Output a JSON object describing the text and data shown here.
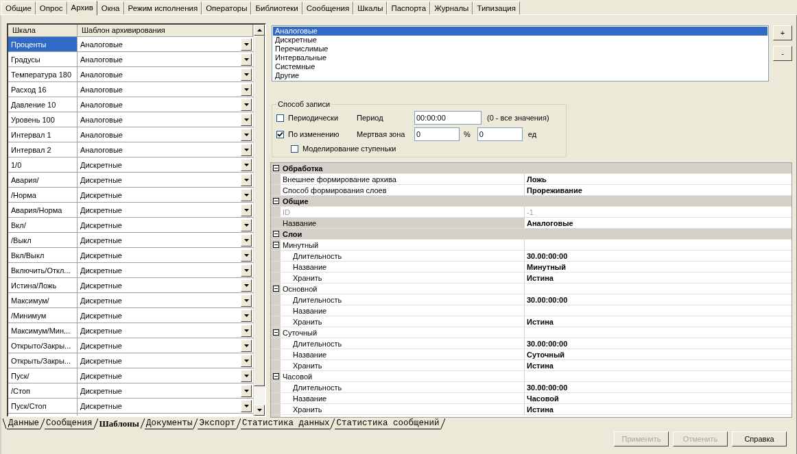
{
  "top_tabs": [
    {
      "label": "Общие",
      "selected": false
    },
    {
      "label": "Опрос",
      "selected": false
    },
    {
      "label": "Архив",
      "selected": true
    },
    {
      "label": "Окна",
      "selected": false
    },
    {
      "label": "Режим исполнения",
      "selected": false
    },
    {
      "label": "Операторы",
      "selected": false
    },
    {
      "label": "Библиотеки",
      "selected": false
    },
    {
      "label": "Сообщения",
      "selected": false
    },
    {
      "label": "Шкалы",
      "selected": false
    },
    {
      "label": "Паспорта",
      "selected": false
    },
    {
      "label": "Журналы",
      "selected": false
    },
    {
      "label": "Типизация",
      "selected": false
    }
  ],
  "scales_table": {
    "columns": [
      "Шкала",
      "Шаблон архивирования"
    ],
    "rows": [
      {
        "scale": "Проценты",
        "template": "Аналоговые",
        "selected": true
      },
      {
        "scale": "Градусы",
        "template": "Аналоговые",
        "selected": false
      },
      {
        "scale": "Температура 180",
        "template": "Аналоговые",
        "selected": false
      },
      {
        "scale": "Расход 16",
        "template": "Аналоговые",
        "selected": false
      },
      {
        "scale": "Давление 10",
        "template": "Аналоговые",
        "selected": false
      },
      {
        "scale": "Уровень 100",
        "template": "Аналоговые",
        "selected": false
      },
      {
        "scale": "Интервал 1",
        "template": "Аналоговые",
        "selected": false
      },
      {
        "scale": "Интервал 2",
        "template": "Аналоговые",
        "selected": false
      },
      {
        "scale": "1/0",
        "template": "Дискретные",
        "selected": false
      },
      {
        "scale": "Авария/",
        "template": "Дискретные",
        "selected": false
      },
      {
        "scale": "/Норма",
        "template": "Дискретные",
        "selected": false
      },
      {
        "scale": "Авария/Норма",
        "template": "Дискретные",
        "selected": false
      },
      {
        "scale": "Вкл/",
        "template": "Дискретные",
        "selected": false
      },
      {
        "scale": "/Выкл",
        "template": "Дискретные",
        "selected": false
      },
      {
        "scale": "Вкл/Выкл",
        "template": "Дискретные",
        "selected": false
      },
      {
        "scale": "Включить/Откл...",
        "template": "Дискретные",
        "selected": false
      },
      {
        "scale": "Истина/Ложь",
        "template": "Дискретные",
        "selected": false
      },
      {
        "scale": "Максимум/",
        "template": "Дискретные",
        "selected": false
      },
      {
        "scale": "/Минимум",
        "template": "Дискретные",
        "selected": false
      },
      {
        "scale": "Максимум/Мин...",
        "template": "Дискретные",
        "selected": false
      },
      {
        "scale": "Открыто/Закры...",
        "template": "Дискретные",
        "selected": false
      },
      {
        "scale": "Открыть/Закры...",
        "template": "Дискретные",
        "selected": false
      },
      {
        "scale": "Пуск/",
        "template": "Дискретные",
        "selected": false
      },
      {
        "scale": "/Стоп",
        "template": "Дискретные",
        "selected": false
      },
      {
        "scale": "Пуск/Стоп",
        "template": "Дискретные",
        "selected": false
      }
    ]
  },
  "templates_list": [
    {
      "label": "Аналоговые",
      "selected": true
    },
    {
      "label": "Дискретные",
      "selected": false
    },
    {
      "label": "Перечислимые",
      "selected": false
    },
    {
      "label": "Интервальные",
      "selected": false
    },
    {
      "label": "Системные",
      "selected": false
    },
    {
      "label": "Другие",
      "selected": false
    }
  ],
  "list_buttons": [
    "+",
    "-"
  ],
  "write_mode": {
    "title": "Способ записи",
    "periodic": {
      "label": "Периодически",
      "checked": false
    },
    "period_label": "Период",
    "period_value": "00:00:00",
    "period_hint": "(0 - все значения)",
    "on_change": {
      "label": "По изменению",
      "checked": true
    },
    "deadband_label": "Мертвая зона",
    "deadband_percent": "0",
    "percent_sign": "%",
    "deadband_units": "0",
    "units_label": "ед",
    "step_modeling": {
      "label": "Моделирование ступеньки",
      "checked": false
    }
  },
  "properties": [
    {
      "kind": "category",
      "name": "Обработка",
      "expanded": true,
      "children": [
        {
          "kind": "property",
          "name": "Внешнее формирование архива",
          "value": "Ложь",
          "disabled": false,
          "selected": false
        },
        {
          "kind": "property",
          "name": "Способ формирования слоев",
          "value": "Прореживание",
          "disabled": false,
          "selected": false
        }
      ]
    },
    {
      "kind": "category",
      "name": "Общие",
      "expanded": true,
      "children": [
        {
          "kind": "property",
          "name": "ID",
          "value": "-1",
          "disabled": true,
          "selected": false
        },
        {
          "kind": "property",
          "name": "Название",
          "value": "Аналоговые",
          "disabled": false,
          "selected": true
        }
      ]
    },
    {
      "kind": "category",
      "name": "Слои",
      "expanded": true,
      "children": [
        {
          "kind": "group",
          "name": "Минутный",
          "expanded": true,
          "children": [
            {
              "kind": "property",
              "name": "Длительность",
              "value": "30.00:00:00",
              "disabled": false,
              "selected": false
            },
            {
              "kind": "property",
              "name": "Название",
              "value": "Минутный",
              "disabled": false,
              "selected": false
            },
            {
              "kind": "property",
              "name": "Хранить",
              "value": "Истина",
              "disabled": false,
              "selected": false
            }
          ]
        },
        {
          "kind": "group",
          "name": "Основной",
          "expanded": true,
          "children": [
            {
              "kind": "property",
              "name": "Длительность",
              "value": "30.00:00:00",
              "disabled": false,
              "selected": false
            },
            {
              "kind": "property",
              "name": "Название",
              "disabled": false,
              "selected": false
            },
            {
              "kind": "property",
              "name": "Хранить",
              "value": "Истина",
              "disabled": false,
              "selected": false
            }
          ]
        },
        {
          "kind": "group",
          "name": "Суточный",
          "expanded": true,
          "children": [
            {
              "kind": "property",
              "name": "Длительность",
              "value": "30.00:00:00",
              "disabled": false,
              "selected": false
            },
            {
              "kind": "property",
              "name": "Название",
              "value": "Суточный",
              "disabled": false,
              "selected": false
            },
            {
              "kind": "property",
              "name": "Хранить",
              "value": "Истина",
              "disabled": false,
              "selected": false
            }
          ]
        },
        {
          "kind": "group",
          "name": "Часовой",
          "expanded": true,
          "children": [
            {
              "kind": "property",
              "name": "Длительность",
              "value": "30.00:00:00",
              "disabled": false,
              "selected": false
            },
            {
              "kind": "property",
              "name": "Название",
              "value": "Часовой",
              "disabled": false,
              "selected": false
            },
            {
              "kind": "property",
              "name": "Хранить",
              "value": "Истина",
              "disabled": false,
              "selected": false
            }
          ]
        }
      ]
    }
  ],
  "sheet_tabs": [
    {
      "label": "Данные",
      "selected": false
    },
    {
      "label": "Сообщения",
      "selected": false
    },
    {
      "label": "Шаблоны",
      "selected": true
    },
    {
      "label": "Документы",
      "selected": false
    },
    {
      "label": "Экспорт",
      "selected": false
    },
    {
      "label": "Статистика данных",
      "selected": false
    },
    {
      "label": "Статистика сообщений",
      "selected": false
    }
  ],
  "buttons": [
    {
      "label": "Применить",
      "disabled": true
    },
    {
      "label": "Отменить",
      "disabled": true
    },
    {
      "label": "Справка",
      "disabled": false
    }
  ]
}
